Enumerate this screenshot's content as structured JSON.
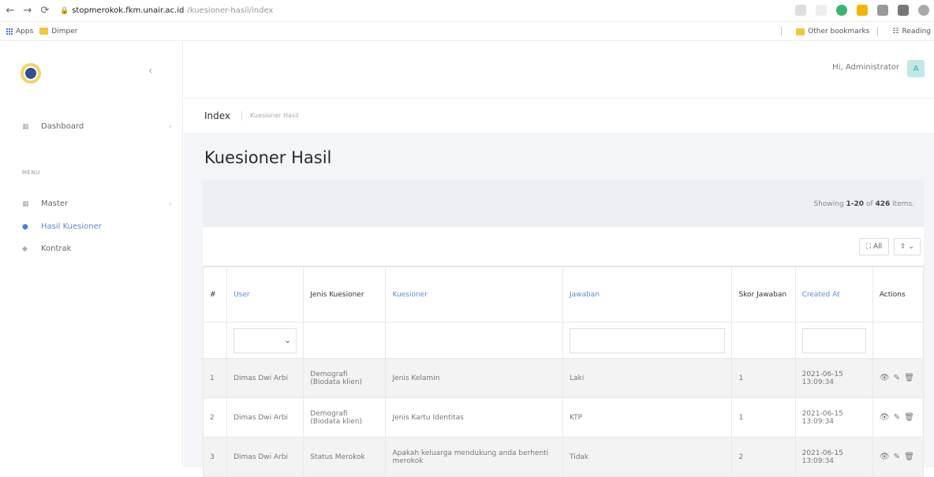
{
  "browser": {
    "url_host": "stopmerokok.fkm.unair.ac.id",
    "url_path": "/kuesioner-hasil/index",
    "bookmarks": [
      "Apps",
      "Dimper"
    ],
    "bookmarks_right": [
      "Other bookmarks",
      "Reading"
    ]
  },
  "sidebar": {
    "items": [
      {
        "label": "Dashboard",
        "icon": "dashboard-icon"
      },
      {
        "label": "Master",
        "icon": "master-icon"
      },
      {
        "label": "Hasil Kuesioner",
        "icon": "circle-icon"
      },
      {
        "label": "Kontrak",
        "icon": "diamond-icon"
      }
    ],
    "menu_label": "MENU"
  },
  "header": {
    "greeting": "Hi, Administrator",
    "avatar_letter": "A"
  },
  "breadcrumb": {
    "title": "Index",
    "current": "Kuesioner Hasil"
  },
  "page": {
    "title": "Kuesioner Hasil"
  },
  "summary": {
    "prefix": "Showing ",
    "range": "1-20",
    "of": " of ",
    "total": "426",
    "suffix": " items."
  },
  "toolbar": {
    "all_label": "All",
    "export_label": "⇪ ⌄"
  },
  "table": {
    "headers": [
      "#",
      "User",
      "Jenis Kuesioner",
      "Kuesioner",
      "Jawaban",
      "Skor Jawaban",
      "Created At",
      "Actions"
    ],
    "rows": [
      {
        "no": "1",
        "user": "Dimas Dwi Arbi",
        "jenis": "Demografi (Biodata klien)",
        "kuesioner": "Jenis Kelamin",
        "jawaban": "Laki",
        "skor": "1",
        "created": "2021-06-15 13:09:34"
      },
      {
        "no": "2",
        "user": "Dimas Dwi Arbi",
        "jenis": "Demografi (Biodata klien)",
        "kuesioner": "Jenis Kartu Identitas",
        "jawaban": "KTP",
        "skor": "1",
        "created": "2021-06-15 13:09:34"
      },
      {
        "no": "3",
        "user": "Dimas Dwi Arbi",
        "jenis": "Status Merokok",
        "kuesioner": "Apakah keluarga mendukung anda berhenti merokok",
        "jawaban": "Tidak",
        "skor": "2",
        "created": "2021-06-15 13:09:34"
      }
    ],
    "action_icons": "👁 ✎ 🗑"
  }
}
